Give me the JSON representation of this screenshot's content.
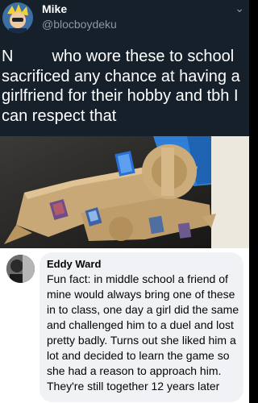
{
  "tweet": {
    "author_name": "Mike",
    "author_handle": "@blocboydeku",
    "text_lead": "N",
    "text_rest": "who wore these to school sacrificed any chance at having a girlfriend for their hobby and tbh I can respect that"
  },
  "comment": {
    "author_name": "Eddy Ward",
    "text": "Fun fact: in middle school a friend of mine would always bring one of these in to class, one day a girl did the same and challenged him to a duel and lost pretty badly. Turns out she liked him a lot and decided to learn the game so she had a reason to approach him. They're still together 12 years later"
  },
  "photo": {
    "alt_icon": "duel-disk-photo",
    "colors": {
      "sleeve": "#2f7fd6",
      "cardboard": "#c9a877"
    }
  }
}
